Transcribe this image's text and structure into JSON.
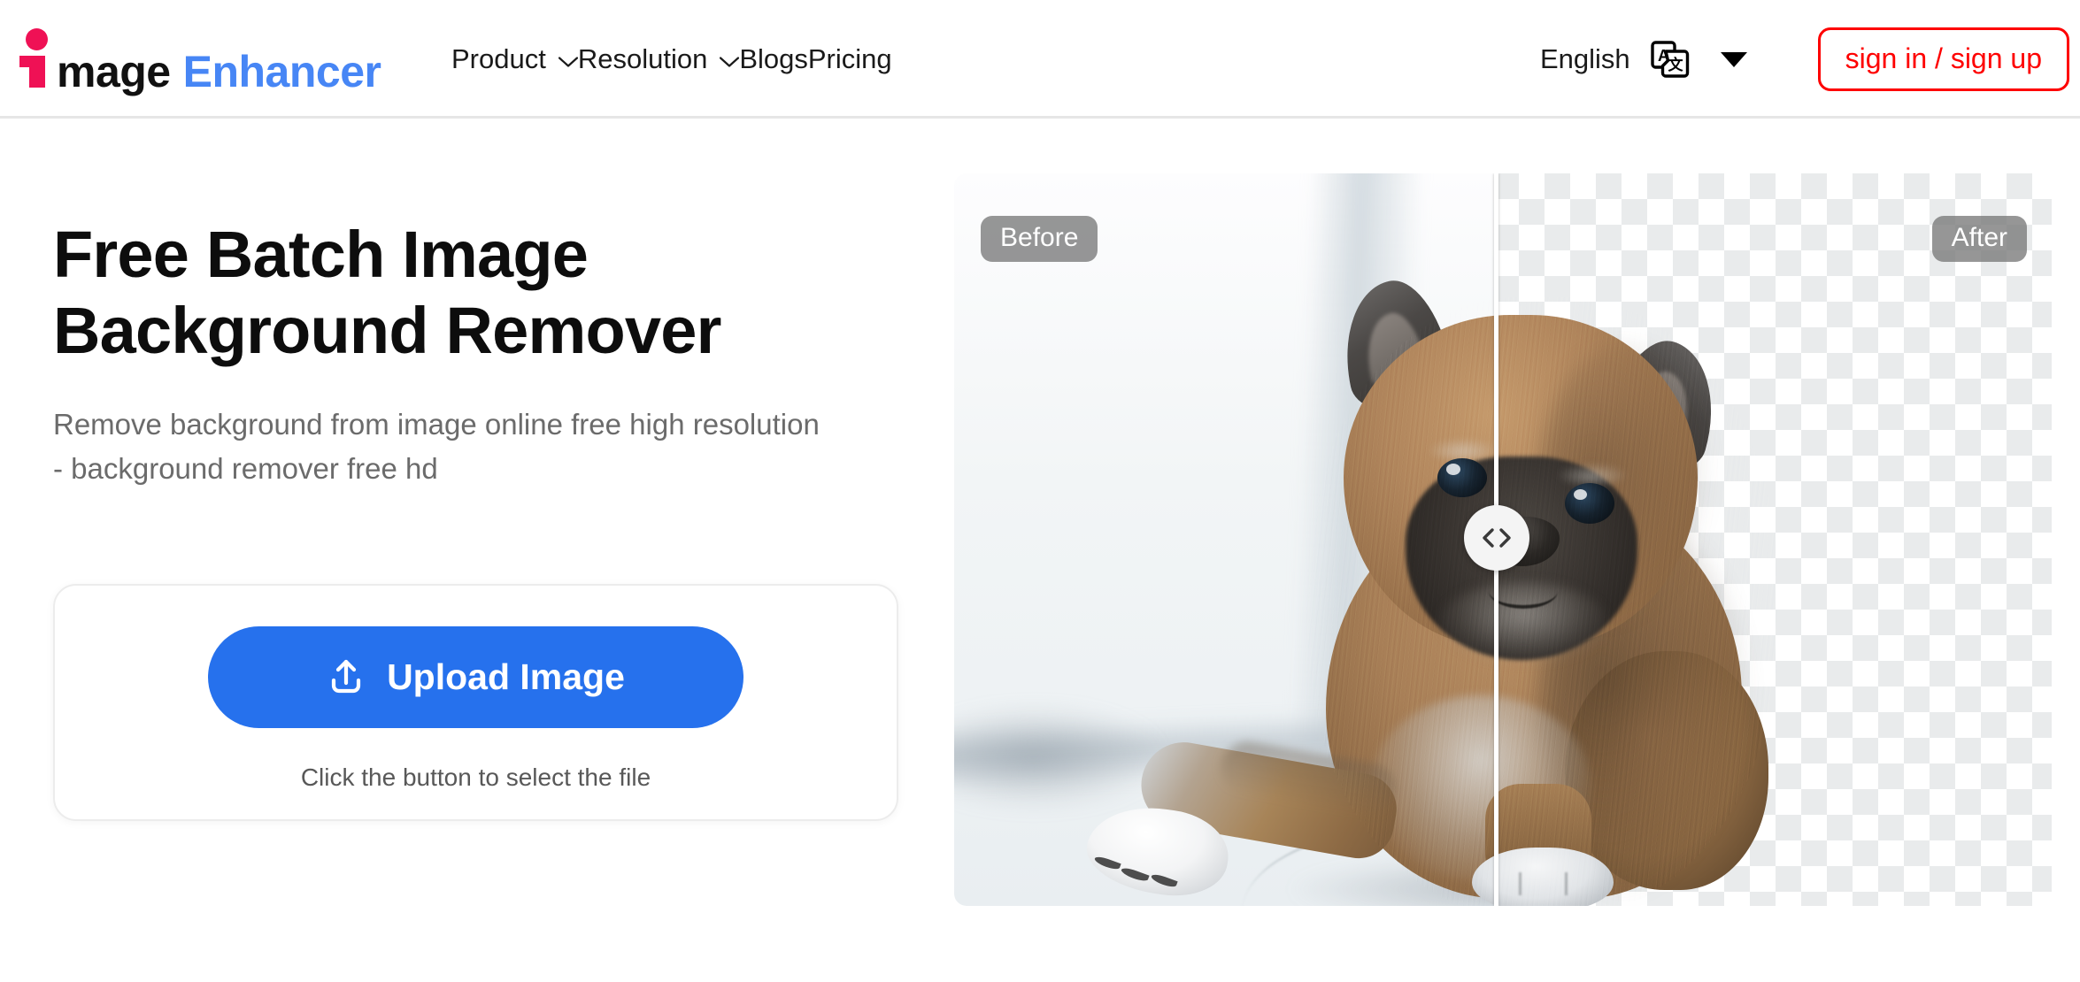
{
  "header": {
    "logo": {
      "part1": "mage",
      "part2": "Enhancer",
      "icon": "logo-i-icon"
    },
    "nav": [
      {
        "label": "Product",
        "has_dropdown": true
      },
      {
        "label": "Resolution",
        "has_dropdown": true
      },
      {
        "label": "Blogs",
        "has_dropdown": false
      },
      {
        "label": "Pricing",
        "has_dropdown": false
      }
    ],
    "language": {
      "label": "English",
      "icon": "translate-icon"
    },
    "auth_button": "sign in / sign up"
  },
  "hero": {
    "title_line1": "Free Batch Image",
    "title_line2": "Background Remover",
    "subtitle_line1": "Remove background from image online free high resolution",
    "subtitle_line2": "- background remover free hd"
  },
  "upload": {
    "button_label": "Upload Image",
    "hint": "Click the button to select the file",
    "icon": "upload-icon"
  },
  "comparison": {
    "before_label": "Before",
    "after_label": "After",
    "handle_icon": "left-right-chevrons-icon",
    "slider_position_percent": 49
  },
  "colors": {
    "brand_pink": "#ef1155",
    "brand_blue": "#4786f5",
    "primary_button": "#2671ed",
    "auth_red": "#fe0000",
    "text_dark": "#0d0d0d",
    "text_muted": "#6b6b6b"
  }
}
